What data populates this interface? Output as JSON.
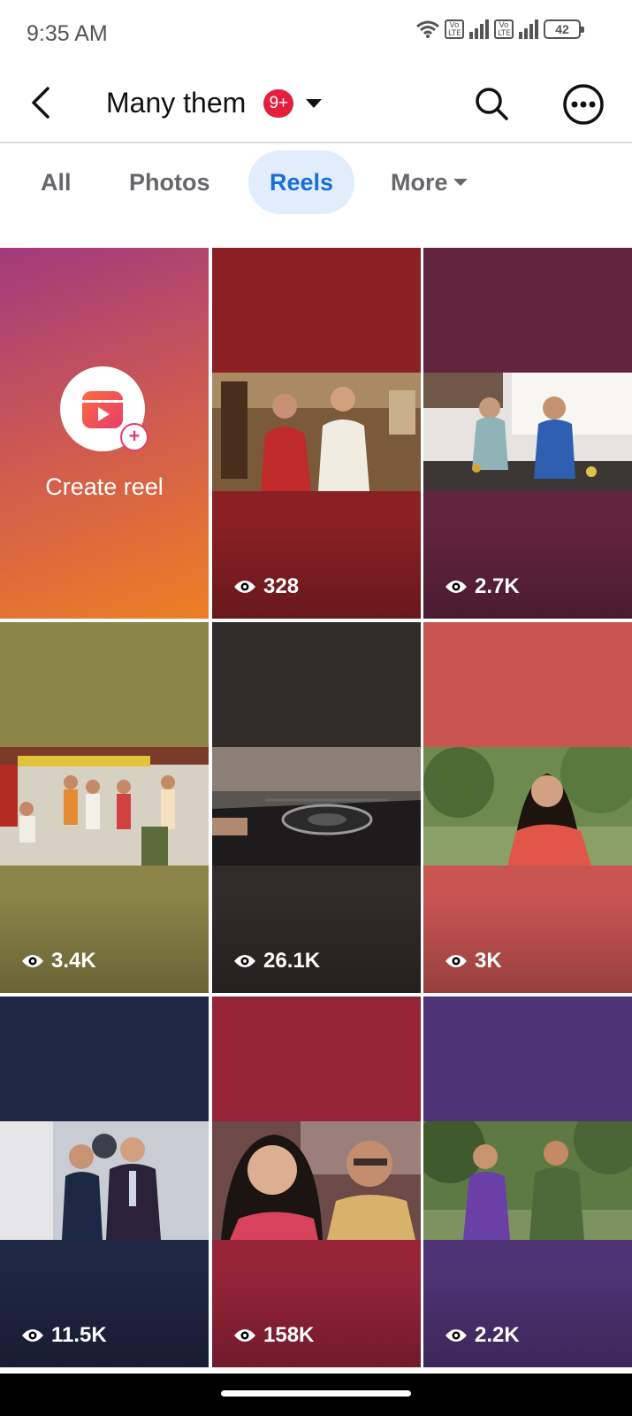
{
  "status_bar": {
    "time": "9:35 AM",
    "volte1": "Vo\nLTE",
    "volte2": "Vo\nLTE",
    "battery": "42",
    "icons": [
      "wifi-icon",
      "volte-icon",
      "signal-icon",
      "volte-icon",
      "signal-icon",
      "battery-icon"
    ]
  },
  "header": {
    "title": "Many them",
    "badge": "9+",
    "icons": [
      "back-arrow-icon",
      "caret-down-icon",
      "search-icon",
      "more-dots-icon"
    ]
  },
  "tabs": [
    {
      "label": "All"
    },
    {
      "label": "Photos"
    },
    {
      "label": "Reels",
      "selected": true
    },
    {
      "label": "More"
    }
  ],
  "create": {
    "label": "Create reel"
  },
  "reels": [
    {
      "views": "328",
      "bg": "#8a2024",
      "bottom": "#6e1a1d"
    },
    {
      "views": "2.7K",
      "bg": "#632440",
      "bottom": "#4f1c34"
    },
    {
      "views": "3.4K",
      "bg": "#8b8547",
      "bottom": "#6e6a3a"
    },
    {
      "views": "26.1K",
      "bg": "#312b2b",
      "bottom": "#262121"
    },
    {
      "views": "3K",
      "bg": "#c95553",
      "bottom": "#a64443"
    },
    {
      "views": "11.5K",
      "bg": "#1f2643",
      "bottom": "#171d34"
    },
    {
      "views": "158K",
      "bg": "#962439",
      "bottom": "#771c2e"
    },
    {
      "views": "2.2K",
      "bg": "#4f3475",
      "bottom": "#3e285c"
    }
  ],
  "colors": {
    "accent": "#1a6ed8",
    "tab_selected_bg": "#e1edfb",
    "badge": "#e41e3f"
  }
}
